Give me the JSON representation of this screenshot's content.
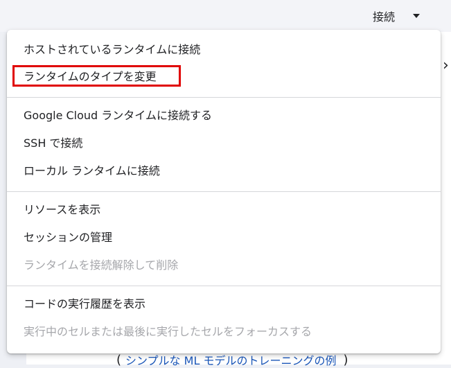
{
  "header": {
    "connect_label": "接続"
  },
  "page": {
    "side_chevron": "›",
    "bottom_link_open": "(",
    "bottom_link_text": "シンプルな ML モデルのトレーニングの例",
    "bottom_link_close": ")"
  },
  "menu": {
    "items": [
      {
        "label": "ホストされているランタイムに接続",
        "disabled": false
      },
      {
        "label": "ランタイムのタイプを変更",
        "disabled": false,
        "highlighted": true
      },
      {
        "label": "Google Cloud ランタイムに接続する",
        "disabled": false
      },
      {
        "label": "SSH で接続",
        "disabled": false
      },
      {
        "label": "ローカル ランタイムに接続",
        "disabled": false
      },
      {
        "label": "リソースを表示",
        "disabled": false
      },
      {
        "label": "セッションの管理",
        "disabled": false
      },
      {
        "label": "ランタイムを接続解除して削除",
        "disabled": true
      },
      {
        "label": "コードの実行履歴を表示",
        "disabled": false
      },
      {
        "label": "実行中のセルまたは最後に実行したセルをフォーカスする",
        "disabled": true
      }
    ]
  },
  "colors": {
    "highlight_border": "#e00000",
    "disabled_text": "#a6a7ab",
    "link": "#1a56b8"
  }
}
